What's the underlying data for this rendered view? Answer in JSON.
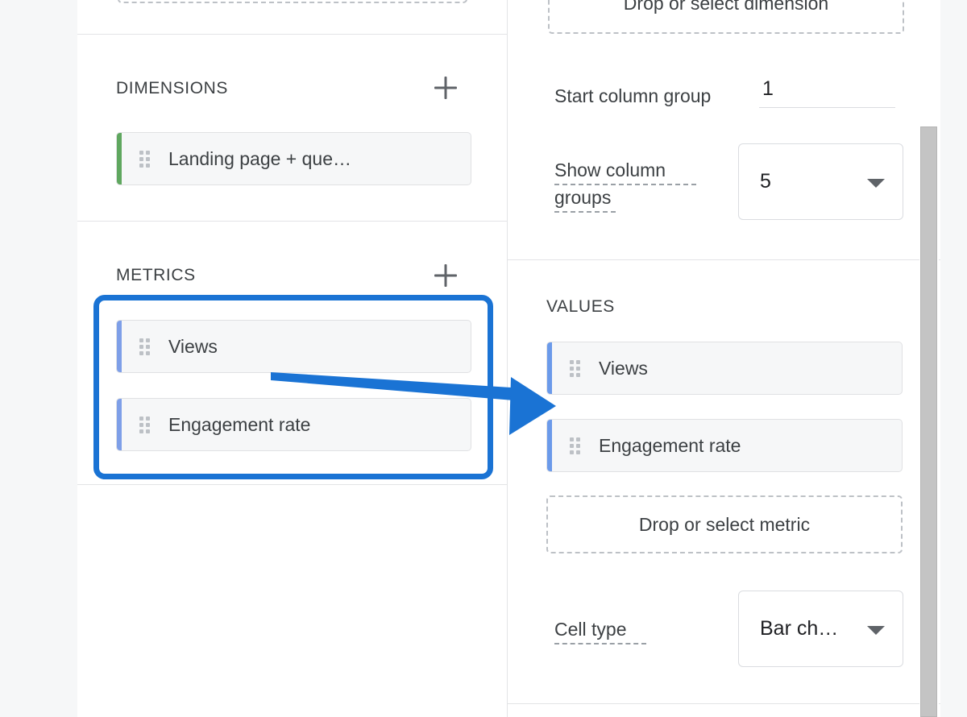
{
  "left_panel": {
    "dimensions": {
      "title": "DIMENSIONS",
      "add_icon": "plus-icon",
      "chips": [
        {
          "label": "Landing page + que…",
          "accent": "#5fa75f"
        }
      ]
    },
    "metrics": {
      "title": "METRICS",
      "add_icon": "plus-icon",
      "chips": [
        {
          "label": "Views",
          "accent": "#7e9fe8"
        },
        {
          "label": "Engagement rate",
          "accent": "#7e9fe8"
        }
      ]
    }
  },
  "right_panel": {
    "column_dropzone": {
      "label": "Drop or select dimension"
    },
    "start_column_group": {
      "label": "Start column group",
      "value": "1"
    },
    "show_column_groups": {
      "label": "Show column groups",
      "value": "5",
      "caret_icon": "chevron-down-icon"
    },
    "values": {
      "title": "VALUES",
      "chips": [
        {
          "label": "Views",
          "accent": "#6b9aea"
        },
        {
          "label": "Engagement rate",
          "accent": "#6b9aea"
        }
      ],
      "dropzone": {
        "label": "Drop or select metric"
      }
    },
    "cell_type": {
      "label": "Cell type",
      "value": "Bar ch…",
      "caret_icon": "chevron-down-icon"
    }
  },
  "annotations": {
    "highlight_color": "#1a73d4",
    "arrow_color": "#1a73d4",
    "highlight_target": "metrics-chip-list",
    "arrow_from": "metrics-chip-list",
    "arrow_to": "values-chip-list"
  },
  "scrollbar": {
    "orientation": "vertical",
    "thumb_color": "#c4c4c4"
  }
}
